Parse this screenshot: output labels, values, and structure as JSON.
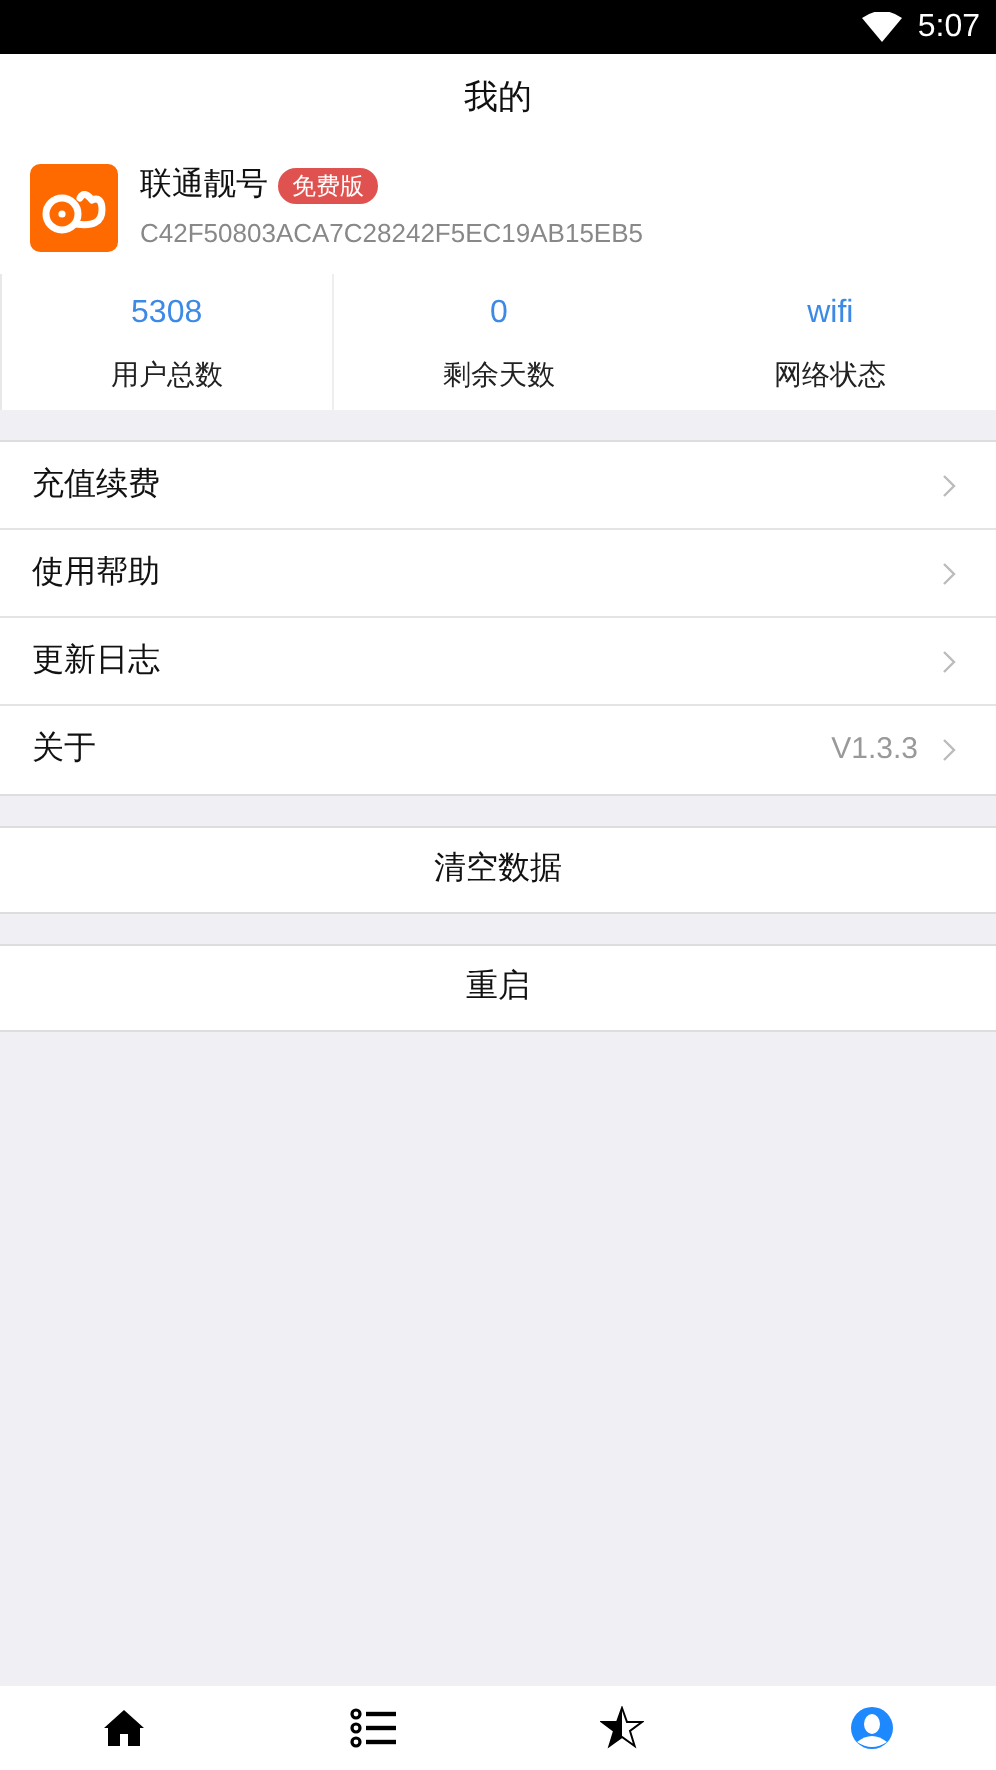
{
  "status_bar": {
    "time": "5:07"
  },
  "header": {
    "title": "我的"
  },
  "profile": {
    "name": "联通靓号",
    "badge": "免费版",
    "device_id": "C42F50803ACA7C28242F5EC19AB15EB5"
  },
  "stats": [
    {
      "value": "5308",
      "label": "用户总数"
    },
    {
      "value": "0",
      "label": "剩余天数"
    },
    {
      "value": "wifi",
      "label": "网络状态"
    }
  ],
  "menu": [
    {
      "label": "充值续费"
    },
    {
      "label": "使用帮助"
    },
    {
      "label": "更新日志"
    },
    {
      "label": "关于",
      "value": "V1.3.3"
    }
  ],
  "actions": [
    "清空数据",
    "重启"
  ],
  "tab_bar": [
    {
      "kind": "home",
      "selected": false
    },
    {
      "kind": "list",
      "selected": false
    },
    {
      "kind": "star",
      "selected": false
    },
    {
      "kind": "user",
      "selected": true
    }
  ]
}
